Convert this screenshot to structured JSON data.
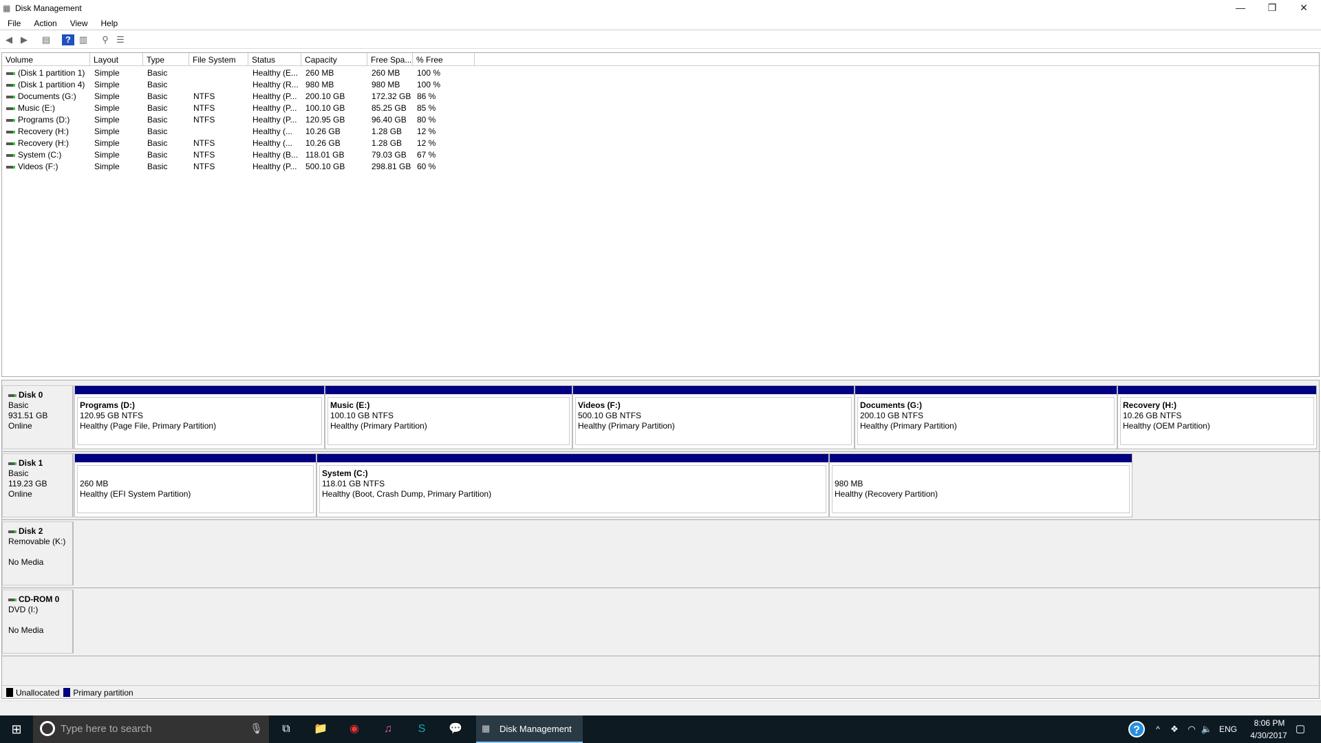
{
  "window": {
    "title": "Disk Management",
    "minimize": "—",
    "restore": "❐",
    "close": "✕"
  },
  "menu": [
    "File",
    "Action",
    "View",
    "Help"
  ],
  "toolbar": [
    {
      "icon": "back-icon",
      "glyph": "◀"
    },
    {
      "icon": "forward-icon",
      "glyph": "▶"
    },
    {
      "icon": "console-tree-icon",
      "glyph": "▤"
    },
    {
      "icon": "help-icon",
      "glyph": "?"
    },
    {
      "icon": "action-pane-icon",
      "glyph": "▥"
    },
    {
      "icon": "connect-icon",
      "glyph": "⚲"
    },
    {
      "icon": "properties-icon",
      "glyph": "☰"
    }
  ],
  "columns": [
    "Volume",
    "Layout",
    "Type",
    "File System",
    "Status",
    "Capacity",
    "Free Spa...",
    "% Free"
  ],
  "volumes": [
    [
      "(Disk 1 partition 1)",
      "Simple",
      "Basic",
      "",
      "Healthy (E...",
      "260 MB",
      "260 MB",
      "100 %"
    ],
    [
      "(Disk 1 partition 4)",
      "Simple",
      "Basic",
      "",
      "Healthy (R...",
      "980 MB",
      "980 MB",
      "100 %"
    ],
    [
      "Documents (G:)",
      "Simple",
      "Basic",
      "NTFS",
      "Healthy (P...",
      "200.10 GB",
      "172.32 GB",
      "86 %"
    ],
    [
      "Music (E:)",
      "Simple",
      "Basic",
      "NTFS",
      "Healthy (P...",
      "100.10 GB",
      "85.25 GB",
      "85 %"
    ],
    [
      "Programs (D:)",
      "Simple",
      "Basic",
      "NTFS",
      "Healthy (P...",
      "120.95 GB",
      "96.40 GB",
      "80 %"
    ],
    [
      "Recovery (H:)",
      "Simple",
      "Basic",
      "",
      "Healthy (...",
      "10.26 GB",
      "1.28 GB",
      "12 %"
    ],
    [
      "Recovery (H:)",
      "Simple",
      "Basic",
      "NTFS",
      "Healthy (...",
      "10.26 GB",
      "1.28 GB",
      "12 %"
    ],
    [
      "System (C:)",
      "Simple",
      "Basic",
      "NTFS",
      "Healthy (B...",
      "118.01 GB",
      "79.03 GB",
      "67 %"
    ],
    [
      "Videos (F:)",
      "Simple",
      "Basic",
      "NTFS",
      "Healthy (P...",
      "500.10 GB",
      "298.81 GB",
      "60 %"
    ]
  ],
  "disks": [
    {
      "name": "Disk 0",
      "lines": [
        "Basic",
        "931.51 GB",
        "Online"
      ],
      "partitions": [
        {
          "name": "Programs  (D:)",
          "size": "120.95 GB NTFS",
          "status": "Healthy (Page File, Primary Partition)"
        },
        {
          "name": "Music  (E:)",
          "size": "100.10 GB NTFS",
          "status": "Healthy (Primary Partition)"
        },
        {
          "name": "Videos  (F:)",
          "size": "500.10 GB NTFS",
          "status": "Healthy (Primary Partition)"
        },
        {
          "name": "Documents  (G:)",
          "size": "200.10 GB NTFS",
          "status": "Healthy (Primary Partition)"
        },
        {
          "name": "Recovery  (H:)",
          "size": "10.26 GB NTFS",
          "status": "Healthy (OEM Partition)"
        }
      ]
    },
    {
      "name": "Disk 1",
      "lines": [
        "Basic",
        "119.23 GB",
        "Online"
      ],
      "partitions": [
        {
          "name": "",
          "size": "260 MB",
          "status": "Healthy (EFI System Partition)"
        },
        {
          "name": "System  (C:)",
          "size": "118.01 GB NTFS",
          "status": "Healthy (Boot, Crash Dump, Primary Partition)"
        },
        {
          "name": "",
          "size": "980 MB",
          "status": "Healthy (Recovery Partition)"
        }
      ]
    },
    {
      "name": "Disk 2",
      "lines": [
        "Removable (K:)",
        "",
        "No Media"
      ],
      "partitions": []
    },
    {
      "name": "CD-ROM 0",
      "lines": [
        "DVD (I:)",
        "",
        "No Media"
      ],
      "partitions": []
    }
  ],
  "legend": [
    {
      "label": "Unallocated",
      "color": "#000000"
    },
    {
      "label": "Primary partition",
      "color": "#000080"
    }
  ],
  "taskbar": {
    "search_placeholder": "Type here to search",
    "active_app": "Disk Management",
    "language": "ENG",
    "time": "8:06 PM",
    "date": "4/30/2017"
  }
}
